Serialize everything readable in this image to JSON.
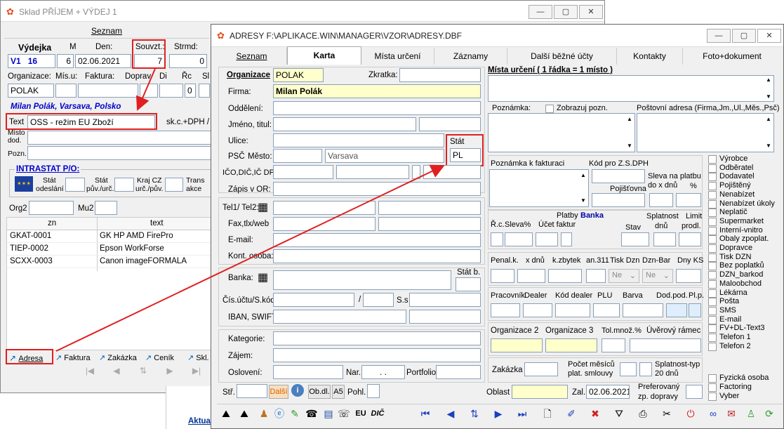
{
  "bgwin": {
    "title": "Sklad PŘÍJEM + VÝDEJ 1",
    "tab": "Seznam",
    "hdr": {
      "vydejka": "Výdejka",
      "m": "M",
      "den": "Den:",
      "souvzt": "Souvzt.:",
      "strmd": "Strmd:"
    },
    "row1": {
      "v1": "V1",
      "num": "16",
      "m": "6",
      "date": "02.06.2021",
      "souvzt": "7",
      "strmd": "0"
    },
    "labels2": {
      "org": "Organizace:",
      "mis": "Mís.u:",
      "fak": "Faktura:",
      "dop": "Doprav",
      "di": "Di",
      "rc": "Řc",
      "sl": "Sl"
    },
    "org_value": "POLAK",
    "rc_val": "0",
    "customer": "Milan Polák,  Varsava, Polsko",
    "text_label": "Text",
    "text_value": "OSS - režim EU Zboží",
    "skc": "sk.c.+DPH /",
    "misto_l1": "Místo",
    "misto_l2": "dod.",
    "pozn": "Pozn.",
    "intrastat": "INTRASTAT P/O:",
    "stat_od1": "Stát",
    "stat_od2": "odeslání",
    "stat_puv1": "Stát",
    "stat_puv2": "pův./urč.",
    "kraj1": "Kraj CZ",
    "kraj2": "urč./pův.",
    "trans1": "Trans",
    "trans2": "akce",
    "org2": "Org2",
    "mu2": "Mu2",
    "col_zn": "zn",
    "col_text": "text",
    "rows": [
      {
        "zn": "GKAT-0001",
        "text": "GK HP AMD FirePro"
      },
      {
        "zn": "TIEP-0002",
        "text": "Epson WorkForse"
      },
      {
        "zn": "SCXX-0003",
        "text": "Canon imageFORMALA"
      }
    ],
    "tabs_bottom": [
      "Adresa",
      "Faktura",
      "Zakázka",
      "Ceník",
      "Skl."
    ],
    "aktual": "Aktua"
  },
  "win": {
    "title": "ADRESY F:\\APLIKACE.WIN\\MANAGER\\VZOR\\ADRESY.DBF",
    "tabs": [
      "Seznam",
      "Karta",
      "Místa určení",
      "Záznamy",
      "Další běžné účty",
      "Kontakty",
      "Foto+dokument"
    ],
    "left": {
      "organizace": "Organizace",
      "org_val": "POLAK",
      "zkratka": "Zkratka:",
      "firma": "Firma:",
      "firma_val": "Milan Polák",
      "oddeleni": "Oddělení:",
      "jmeno": "Jméno, titul:",
      "ulice": "Ulice:",
      "stat": "Stát",
      "stat_val": "PL",
      "psc": "PSČ",
      "mesto": "Město:",
      "mesto_val": "Varsava",
      "ico": "IČO,DIČ,IČ DPH",
      "zapis": "Zápis v OR:",
      "tel": "Tel1/ Tel2:",
      "fax": "Fax,tlx/web",
      "email": "E-mail:",
      "kont": "Kont. osoba:",
      "banka": "Banka:",
      "statb": "Stát b.",
      "cis": "Čís.účtu/S.kód",
      "slash": "/",
      "ss": "S.s",
      "iban": "IBAN, SWIFT",
      "kategorie": "Kategorie:",
      "zajem": "Zájem:",
      "osloveni": "Oslovení:",
      "nar": "Nar.",
      "nar_val": ". .",
      "portfolio": "Portfolio",
      "str": "Stř.",
      "dalsi": "Další",
      "obdl": "Ob.dl.",
      "a5": "A5",
      "pohl": "Pohl."
    },
    "right": {
      "misto": "Místa určení ( 1 řádka = 1 místo )",
      "poznamka": "Poznámka:",
      "zobrazuj": "Zobrazuj pozn.",
      "postovni": "Poštovní adresa (Firma,Jm.,Ul.,Měs.,Psč)",
      "pozfak": "Poznámka k fakturaci",
      "kod": "Kód pro Z.S.DPH",
      "pojist": "Pojišťovna",
      "splatnost_l1": "Sleva na platbu",
      "splatnost_l2": "do x dnů",
      "pct": "%",
      "platby": "Platby",
      "banka": "Banka",
      "rc": "Ř.c.",
      "sleva": "Sleva%",
      "ucet": "Účet faktur",
      "stav": "Stav",
      "spl1": "Splatnost",
      "spl2": "dnů",
      "lim1": "Limit",
      "lim2": "prodl.",
      "penal": "Penal.k.",
      "xdnu": "x dnů",
      "kzbytek": "k.zbytek",
      "an311": "an.311",
      "tiskdzn": "Tisk Dzn",
      "dznbar": "Dzn-Bar",
      "dnyks": "Dny KS",
      "ne1": "Ne",
      "ne2": "Ne",
      "prac": "Pracovník",
      "dealer": "Dealer",
      "koddealer": "Kód dealer",
      "plu": "PLU",
      "barva": "Barva",
      "dodpod": "Dod.pod.",
      "plp": "Pl.p.",
      "org2": "Organizace 2",
      "org3": "Organizace 3",
      "tolmnoz": "Tol.množ.%",
      "uver": "Úvěrový rámec",
      "zakazka": "Zakázka",
      "pocet1": "Počet měsíců",
      "pocet2": "plat. smlouvy",
      "spltyp1": "Splatnost-typ",
      "spltyp2": "20 dnů",
      "oblast": "Oblast",
      "zal": "Zal.",
      "zal_val": "02.06.2021",
      "pref1": "Preferovaný",
      "pref2": "zp. dopravy"
    },
    "checks": [
      "Výrobce",
      "Odběratel",
      "Dodavatel",
      "Pojištěný",
      "Nenabízet",
      "Nenabízet úkoly",
      "Neplatič",
      "Supermarket",
      "Interní-vnitro",
      "Obaly zpoplat.",
      "Dopravce",
      "Tisk DZN",
      "Bez poplatků",
      "DZN_barkod",
      "Maloobchod",
      "Lékárna",
      "Pošta",
      "SMS",
      "E-mail",
      "FV+DL-Text3",
      "Telefon 1",
      "Telefon 2"
    ],
    "checks2": [
      "Fyzická osoba",
      "Factoring",
      "Vyber"
    ],
    "eu": "EU",
    "dic": "DIČ"
  },
  "colors": {
    "accent": "#0000cc",
    "red": "#e02020",
    "yellow": "#ffffcc",
    "input_blue": "#dfeefc"
  }
}
